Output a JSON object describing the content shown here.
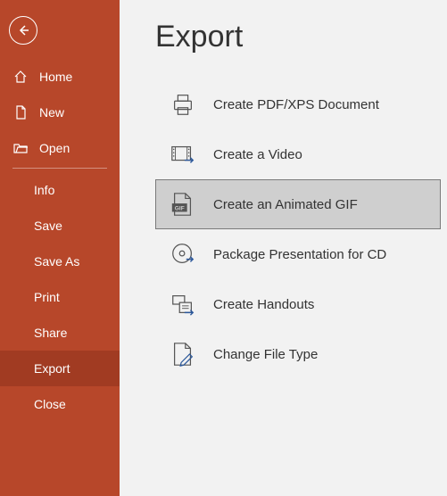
{
  "colors": {
    "sidebar": "#b7472a",
    "sidebar_selected": "#a13b22",
    "accent_blue": "#2b579a"
  },
  "page": {
    "title": "Export"
  },
  "sidebar": {
    "top": [
      {
        "label": "Home",
        "icon": "home-icon"
      },
      {
        "label": "New",
        "icon": "new-file-icon"
      },
      {
        "label": "Open",
        "icon": "open-folder-icon"
      }
    ],
    "items": [
      {
        "label": "Info"
      },
      {
        "label": "Save"
      },
      {
        "label": "Save As"
      },
      {
        "label": "Print"
      },
      {
        "label": "Share"
      },
      {
        "label": "Export",
        "selected": true
      },
      {
        "label": "Close"
      }
    ]
  },
  "export_options": [
    {
      "label": "Create PDF/XPS Document",
      "icon": "printer-pdf-icon",
      "selected": false
    },
    {
      "label": "Create a Video",
      "icon": "filmstrip-icon",
      "selected": false
    },
    {
      "label": "Create an Animated GIF",
      "icon": "gif-file-icon",
      "selected": true
    },
    {
      "label": "Package Presentation for CD",
      "icon": "cd-icon",
      "selected": false
    },
    {
      "label": "Create Handouts",
      "icon": "handouts-icon",
      "selected": false
    },
    {
      "label": "Change File Type",
      "icon": "change-filetype-icon",
      "selected": false
    }
  ]
}
